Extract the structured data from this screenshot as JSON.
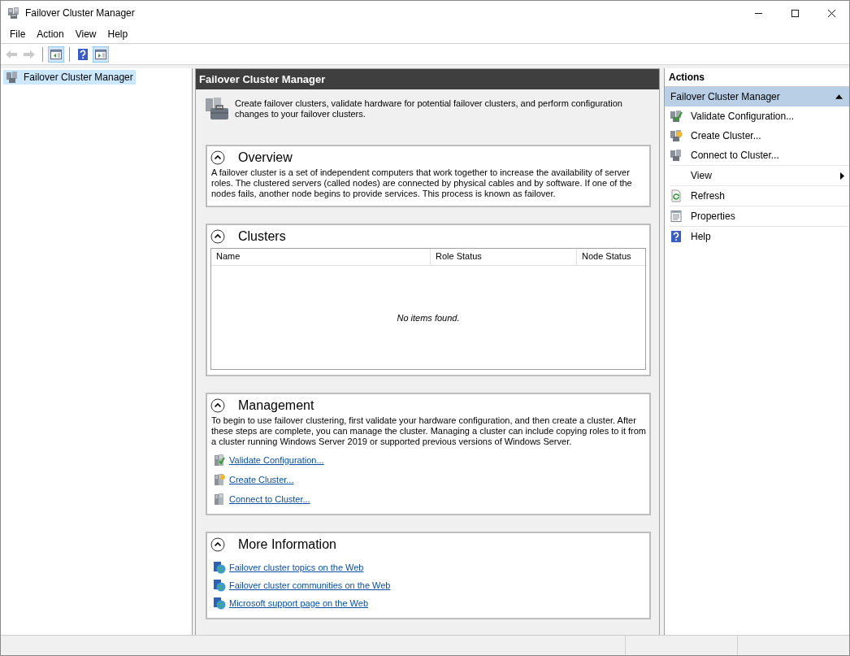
{
  "window": {
    "title": "Failover Cluster Manager"
  },
  "menu": [
    "File",
    "Action",
    "View",
    "Help"
  ],
  "toolbar": [
    {
      "kind": "back",
      "disabled": true,
      "pressed": false
    },
    {
      "kind": "forward",
      "disabled": true,
      "pressed": false
    },
    {
      "kind": "console-tree",
      "disabled": false,
      "pressed": true
    },
    {
      "kind": "help",
      "disabled": false,
      "pressed": false
    },
    {
      "kind": "action-pane",
      "disabled": false,
      "pressed": true
    }
  ],
  "tree": {
    "items": [
      {
        "label": "Failover Cluster Manager",
        "selected": true
      }
    ]
  },
  "center": {
    "header": "Failover Cluster Manager",
    "intro": "Create failover clusters, validate hardware for potential failover clusters, and perform configuration changes to your failover clusters.",
    "sections": [
      {
        "kind": "text",
        "title": "Overview",
        "expanded": true,
        "text": "A failover cluster is a set of independent computers that work together to increase the availability of server roles. The clustered servers (called nodes) are connected by physical cables and by software. If one of the nodes fails, another node begins to provide services. This process is known as failover."
      },
      {
        "kind": "table",
        "title": "Clusters",
        "expanded": true,
        "columns": [
          "Name",
          "Role Status",
          "Node Status"
        ],
        "empty_message": "No items found."
      },
      {
        "kind": "links",
        "title": "Management",
        "expanded": true,
        "text": "To begin to use failover clustering, first validate your hardware configuration, and then create a cluster.  After these steps are complete, you can manage the cluster. Managing a cluster can include copying roles to it from a cluster running Windows Server 2019 or supported previous versions of Windows Server.",
        "links": [
          "Validate Configuration...",
          "Create Cluster...",
          "Connect to Cluster..."
        ]
      },
      {
        "kind": "weblinks",
        "title": "More Information",
        "expanded": true,
        "links": [
          "Failover cluster topics on the Web",
          "Failover cluster communities on the Web",
          "Microsoft support page on the Web"
        ]
      }
    ]
  },
  "actions": {
    "title": "Actions",
    "group": {
      "label": "Failover Cluster Manager",
      "expanded": true
    },
    "items": [
      {
        "kind": "action",
        "label": "Validate Configuration..."
      },
      {
        "kind": "action",
        "label": "Create Cluster..."
      },
      {
        "kind": "action",
        "label": "Connect to Cluster..."
      },
      {
        "kind": "submenu",
        "label": "View"
      },
      {
        "kind": "action",
        "label": "Refresh"
      },
      {
        "kind": "action",
        "label": "Properties"
      },
      {
        "kind": "action",
        "label": "Help"
      }
    ]
  }
}
